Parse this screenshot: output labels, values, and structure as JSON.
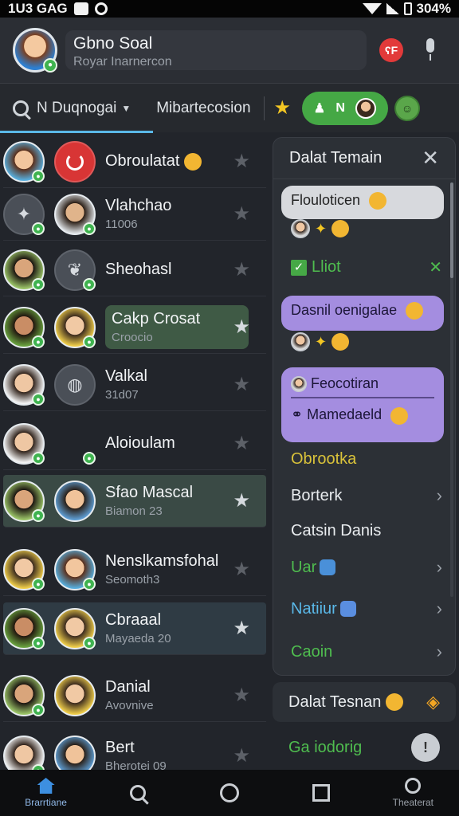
{
  "status_bar": {
    "time": "1U3 GAG",
    "battery": "304%"
  },
  "header": {
    "name": "Gbno Soal",
    "subtitle": "Royar Inarnercon",
    "badge": "ʕF"
  },
  "tabs": {
    "search_label": "N Duqnogai",
    "second_tab": "Mibartecosion",
    "pill_text": "N"
  },
  "chats": [
    {
      "name": "Obroulatat",
      "sub": ""
    },
    {
      "name": "Vlahchao",
      "sub": "11006"
    },
    {
      "name": "Sheohasl",
      "sub": ""
    },
    {
      "name": "Cakp Crosat",
      "sub": "Croocio"
    },
    {
      "name": "Valkal",
      "sub": "31d07"
    },
    {
      "name": "Aloioulam",
      "sub": ""
    },
    {
      "name": "Sfao Mascal",
      "sub": "Biamon 23"
    },
    {
      "name": "Nenslkamsfohal",
      "sub": "Seomoth3"
    },
    {
      "name": "Cbraaal",
      "sub": "Mayaeda 20"
    },
    {
      "name": "Danial",
      "sub": "Avovnive"
    },
    {
      "name": "Bert",
      "sub": "Bherotei 09"
    }
  ],
  "panel": {
    "title": "Dalat Temain",
    "bubble1": "Flouloticen",
    "check_label": "Lliot",
    "bubble2": "Dasnil oenigalae",
    "bubble3_title": "Feocotiran",
    "bubble3_body": "Mamedaeld",
    "menu": [
      {
        "label": "Obrootka",
        "color": "#d9c23a"
      },
      {
        "label": "Borterk",
        "color": "#f1f3f5"
      },
      {
        "label": "Catsin Danis",
        "color": "#f1f3f5"
      },
      {
        "label": "Uar",
        "color": "#4fbd4f"
      },
      {
        "label": "Natiiur",
        "color": "#5ab8e8"
      },
      {
        "label": "Caoin",
        "color": "#4fbd4f"
      }
    ]
  },
  "bottom_cards": {
    "card1": "Dalat Tesnan",
    "card2": "Ga iodorig"
  },
  "bottom_nav": {
    "home_label": "Brarrtiane",
    "last_label": "Theaterat"
  }
}
